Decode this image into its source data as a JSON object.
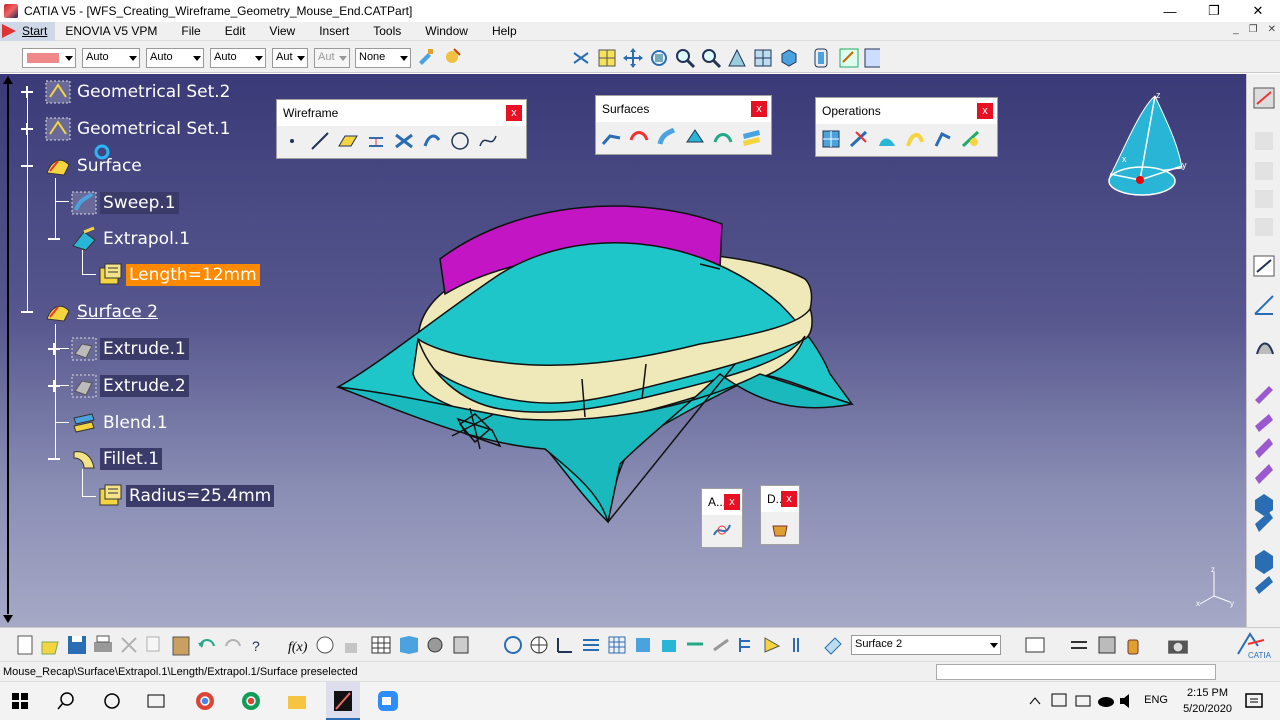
{
  "window": {
    "title": "CATIA V5 - [WFS_Creating_Wireframe_Geometry_Mouse_End.CATPart]",
    "minimize_icon": "minimize-icon",
    "maximize_icon": "restore-icon",
    "close_icon": "close-icon"
  },
  "menubar": {
    "start": "Start",
    "items": [
      "ENOVIA V5 VPM",
      "File",
      "Edit",
      "View",
      "Insert",
      "Tools",
      "Window",
      "Help"
    ]
  },
  "toolbar": {
    "color_swatch": "#f08a8a",
    "combos": [
      "Auto",
      "Auto",
      "Auto",
      "Aut",
      "Aut",
      "None"
    ]
  },
  "tree": {
    "nodes": [
      {
        "label": "Geometrical Set.2",
        "icon": "geometrical-set-icon",
        "expander": "plus"
      },
      {
        "label": "Geometrical Set.1",
        "icon": "geometrical-set-icon",
        "expander": "plus"
      },
      {
        "label": "Surface",
        "icon": "surface-set-icon",
        "expander": "minus"
      },
      {
        "label": "Sweep.1",
        "icon": "sweep-icon"
      },
      {
        "label": "Extrapol.1",
        "icon": "extrapol-icon",
        "expander": "minus"
      },
      {
        "label": "Length=12mm",
        "icon": "parameter-icon"
      },
      {
        "label": "Surface 2",
        "icon": "surface-set-icon",
        "expander": "minus"
      },
      {
        "label": "Extrude.1",
        "icon": "extrude-icon",
        "expander": "plus"
      },
      {
        "label": "Extrude.2",
        "icon": "extrude-icon",
        "expander": "plus"
      },
      {
        "label": "Blend.1",
        "icon": "blend-icon"
      },
      {
        "label": "Fillet.1",
        "icon": "fillet-icon",
        "expander": "minus"
      },
      {
        "label": "Radius=25.4mm",
        "icon": "parameter-icon"
      }
    ]
  },
  "panels": {
    "wireframe": {
      "title": "Wireframe",
      "close": "x"
    },
    "surfaces": {
      "title": "Surfaces",
      "close": "x"
    },
    "operations": {
      "title": "Operations",
      "close": "x"
    },
    "small_a": {
      "title": "A...",
      "close": "x"
    },
    "small_d": {
      "title": "D...",
      "close": "x"
    }
  },
  "colors": {
    "surface_cyan": "#1fc6c9",
    "band_cream": "#efe8b8",
    "band_magenta": "#c415c4",
    "highlight": "#ff8a00"
  },
  "bottom": {
    "current_set": "Surface 2"
  },
  "status": {
    "text": "Mouse_Recap\\Surface\\Extrapol.1\\Length/Extrapol.1/Surface  preselected"
  },
  "taskbar": {
    "lang": "ENG",
    "time": "2:15 PM",
    "date": "5/20/2020"
  }
}
